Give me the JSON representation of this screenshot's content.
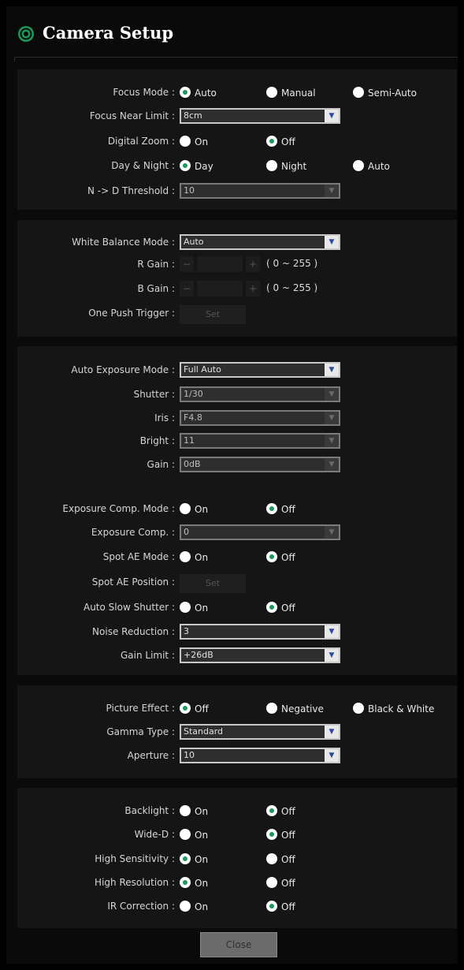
{
  "window": {
    "title": "Camera Setup",
    "icon": "camera-ring-icon",
    "accent": "#1a9a5a"
  },
  "focus": {
    "focus_mode": {
      "label": "Focus Mode :",
      "options": [
        "Auto",
        "Manual",
        "Semi-Auto"
      ],
      "selected": "Auto"
    },
    "focus_near_limit": {
      "label": "Focus Near Limit :",
      "value": "8cm"
    },
    "digital_zoom": {
      "label": "Digital Zoom :",
      "options": [
        "On",
        "Off"
      ],
      "selected": "Off"
    },
    "day_night": {
      "label": "Day & Night :",
      "options": [
        "Day",
        "Night",
        "Auto"
      ],
      "selected": "Day"
    },
    "nd_threshold": {
      "label": "N -> D Threshold :",
      "value": "10"
    }
  },
  "white_balance": {
    "mode": {
      "label": "White Balance Mode :",
      "value": "Auto"
    },
    "r_gain": {
      "label": "R Gain :",
      "minus": "−",
      "plus": "+",
      "range": "( 0 ~ 255 )"
    },
    "b_gain": {
      "label": "B Gain :",
      "minus": "−",
      "plus": "+",
      "range": "( 0 ~ 255 )"
    },
    "one_push": {
      "label": "One Push Trigger :",
      "button": "Set"
    }
  },
  "exposure": {
    "ae_mode": {
      "label": "Auto Exposure Mode :",
      "value": "Full Auto"
    },
    "shutter": {
      "label": "Shutter :",
      "value": "1/30"
    },
    "iris": {
      "label": "Iris :",
      "value": "F4.8"
    },
    "bright": {
      "label": "Bright :",
      "value": "11"
    },
    "gain": {
      "label": "Gain :",
      "value": "0dB"
    },
    "comp_mode": {
      "label": "Exposure Comp. Mode :",
      "options": [
        "On",
        "Off"
      ],
      "selected": "Off"
    },
    "comp": {
      "label": "Exposure Comp. :",
      "value": "0"
    },
    "spot_ae_mode": {
      "label": "Spot AE Mode :",
      "options": [
        "On",
        "Off"
      ],
      "selected": "Off"
    },
    "spot_ae_position": {
      "label": "Spot AE Position :",
      "button": "Set"
    },
    "auto_slow_shutter": {
      "label": "Auto Slow Shutter :",
      "options": [
        "On",
        "Off"
      ],
      "selected": "Off"
    },
    "noise_reduction": {
      "label": "Noise Reduction :",
      "value": "3"
    },
    "gain_limit": {
      "label": "Gain Limit :",
      "value": "+26dB"
    }
  },
  "picture": {
    "picture_effect": {
      "label": "Picture Effect :",
      "options": [
        "Off",
        "Negative",
        "Black & White"
      ],
      "selected": "Off"
    },
    "gamma_type": {
      "label": "Gamma Type :",
      "value": "Standard"
    },
    "aperture": {
      "label": "Aperture :",
      "value": "10"
    }
  },
  "misc": {
    "backlight": {
      "label": "Backlight :",
      "options": [
        "On",
        "Off"
      ],
      "selected": "Off"
    },
    "wide_d": {
      "label": "Wide-D :",
      "options": [
        "On",
        "Off"
      ],
      "selected": "Off"
    },
    "high_sensitivity": {
      "label": "High Sensitivity :",
      "options": [
        "On",
        "Off"
      ],
      "selected": "On"
    },
    "high_resolution": {
      "label": "High Resolution :",
      "options": [
        "On",
        "Off"
      ],
      "selected": "On"
    },
    "ir_correction": {
      "label": "IR Correction :",
      "options": [
        "On",
        "Off"
      ],
      "selected": "Off"
    }
  },
  "footer": {
    "close_label": "Close"
  }
}
